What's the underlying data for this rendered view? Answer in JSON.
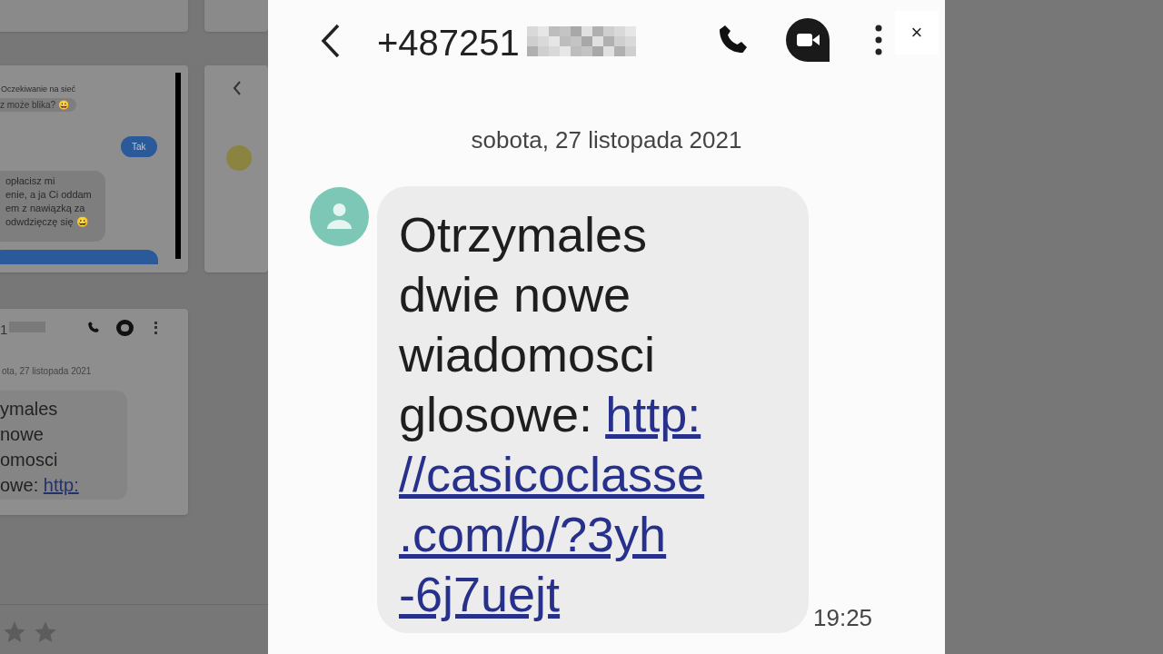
{
  "background_page": {
    "thumbnails": [
      {
        "kind": "chat",
        "status": "Oczekiwanie na sieć",
        "lines": [
          "z może blika? 😀"
        ],
        "reply": "Tak",
        "message": [
          "opłacisz mi",
          "enie, a ja Ci oddam",
          "em z nawiązką za",
          "odwdzięczę się 😀"
        ]
      },
      {
        "kind": "contact"
      },
      {
        "kind": "sms",
        "number": "1",
        "date": "ota, 27 listopada 2021",
        "message": [
          "ymales",
          "nowe",
          "omosci",
          "owe: "
        ],
        "link": "http:"
      }
    ]
  },
  "lightbox": {
    "close": "×",
    "header": {
      "number": "+487251"
    },
    "date": "sobota, 27 listopada 2021",
    "message": {
      "text_lines": [
        "Otrzymales",
        "dwie nowe",
        "wiadomosci",
        "glosowe:"
      ],
      "link_lines": [
        "http:",
        "//casicoclasse",
        ".com/b/?3yh",
        "-6j7uejt"
      ],
      "time": "19:25"
    }
  }
}
